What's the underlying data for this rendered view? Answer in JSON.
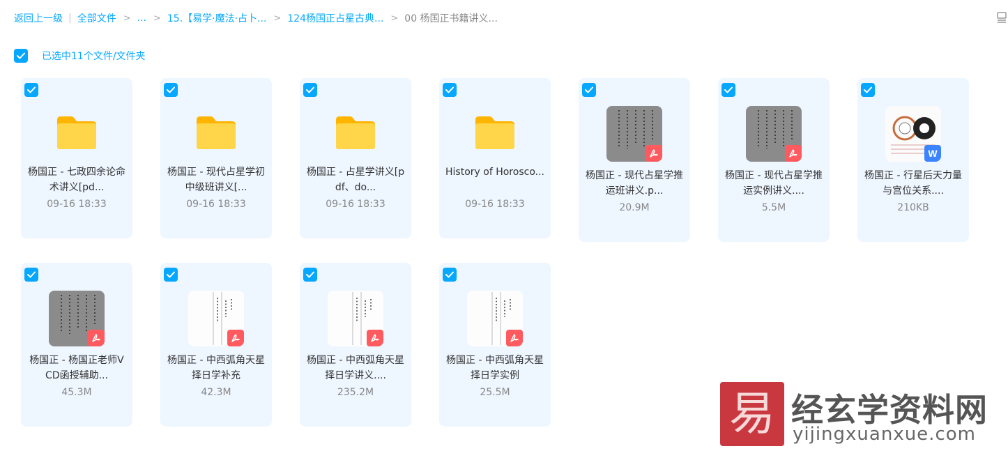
{
  "breadcrumb": {
    "back": "返回上一级",
    "root": "全部文件",
    "ellipsis": "...",
    "level1": "15.【易学·魔法·占卜...",
    "level2": "124杨国正占星古典...",
    "current": "00 杨国正书籍讲义..."
  },
  "selection": {
    "label": "已选中11个文件/文件夹",
    "checked": true
  },
  "files": [
    {
      "type": "folder",
      "name": "杨国正 - 七政四余论命术讲义[pd...",
      "meta": "09-16 18:33",
      "checked": true
    },
    {
      "type": "folder",
      "name": "杨国正 - 现代占星学初中级班讲义[...",
      "meta": "09-16 18:33",
      "checked": true
    },
    {
      "type": "folder",
      "name": "杨国正 - 占星学讲义[pdf、do...",
      "meta": "09-16 18:33",
      "checked": true
    },
    {
      "type": "folder",
      "name": "History of Horosco...",
      "meta": "09-16 18:33",
      "checked": true
    },
    {
      "type": "pdf",
      "thumb": "gray",
      "name": "杨国正 - 现代占星学推运班讲义.p...",
      "meta": "20.9M",
      "checked": true
    },
    {
      "type": "pdf",
      "thumb": "gray",
      "name": "杨国正 - 现代占星学推运实例讲义....",
      "meta": "5.5M",
      "checked": true
    },
    {
      "type": "word",
      "thumb": "chart",
      "name": "杨国正 - 行星后天力量与宫位关系....",
      "meta": "210KB",
      "checked": true
    },
    {
      "type": "pdf",
      "thumb": "gray",
      "name": "杨国正 - 杨国正老师VCD函授辅助...",
      "meta": "45.3M",
      "checked": true
    },
    {
      "type": "pdf",
      "thumb": "white",
      "name": "杨国正 - 中西弧角天星择日学补充",
      "meta": "42.3M",
      "checked": true
    },
    {
      "type": "pdf",
      "thumb": "white",
      "name": "杨国正 - 中西弧角天星择日学讲义....",
      "meta": "235.2M",
      "checked": true
    },
    {
      "type": "pdf",
      "thumb": "white",
      "name": "杨国正 - 中西弧角天星择日学实例",
      "meta": "25.5M",
      "checked": true
    }
  ],
  "icons": {
    "folder": "folder-icon",
    "pdf": "pdf-icon",
    "word": "word-icon",
    "check": "checkmark-icon",
    "layout": "list-layout-icon"
  },
  "colors": {
    "accent": "#06a7ff",
    "card_bg": "#eef6ff",
    "pdf_badge": "#ff5a5f",
    "word_badge": "#3b83ff",
    "folder": "#ffc831"
  },
  "watermark": {
    "logo_char": "易",
    "title": "经玄学资料网",
    "url": "yijingxuanxue.com"
  }
}
